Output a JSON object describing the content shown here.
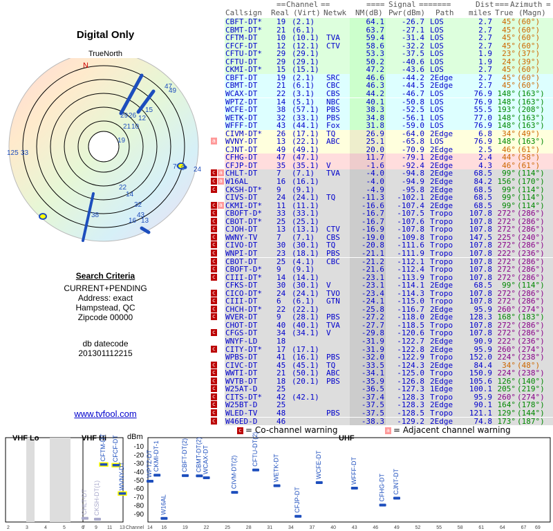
{
  "page": {
    "title": "Digital Only",
    "true_north": "TrueNorth",
    "compass_n": "N",
    "criteria_header": "Search Criteria",
    "criteria_lines": [
      "CURRENT+PENDING",
      "Address: exact",
      "Hampstead, QC",
      "Zipcode 00000"
    ],
    "datecode_label": "db datecode",
    "datecode": "201301112215",
    "site": "www.tvfool.com"
  },
  "radar_labels": [
    "47",
    "49",
    "15",
    "12",
    "29",
    "26",
    "10",
    "19",
    "21",
    "33",
    "7",
    "9",
    "24",
    "38",
    "22",
    "14",
    "32",
    "43",
    "16",
    "13",
    "125"
  ],
  "table_header": {
    "group_channel": "Channel",
    "group_signal": "Signal",
    "group_dist": "Dist",
    "group_azimuth": "Azimuth",
    "callsign": "Callsign",
    "real": "Real",
    "virt": "(Virt)",
    "netwk": "Netwk",
    "nm": "NM(dB)",
    "pwr": "Pwr(dBm)",
    "path": "Path",
    "miles": "miles",
    "true": "True",
    "magn": "(Magn)"
  },
  "colors": {
    "green": "#dfd",
    "cyan": "#dff",
    "yellow": "#ffd",
    "pink": "#fdd",
    "gray": "#ddd",
    "nm_green": "#cfc"
  },
  "rows": [
    {
      "cs": "CBFT-DT*",
      "real": "19",
      "virt": "(2.1)",
      "net": "",
      "nm": "64.1",
      "pwr": "-26.7",
      "path": "LOS",
      "dist": "2.7",
      "true": "45°",
      "magn": "(60°)",
      "bg": "green",
      "az": "#c60",
      "warn": ""
    },
    {
      "cs": "CBMT-DT*",
      "real": "21",
      "virt": "(6.1)",
      "net": "",
      "nm": "63.7",
      "pwr": "-27.1",
      "path": "LOS",
      "dist": "2.7",
      "true": "45°",
      "magn": "(60°)",
      "bg": "green",
      "az": "#c60",
      "warn": ""
    },
    {
      "cs": "CFTM-DT",
      "real": "10",
      "virt": "(10.1)",
      "net": "TVA",
      "nm": "59.4",
      "pwr": "-31.4",
      "path": "LOS",
      "dist": "2.7",
      "true": "45°",
      "magn": "(60°)",
      "bg": "green",
      "az": "#c60",
      "warn": ""
    },
    {
      "cs": "CFCF-DT",
      "real": "12",
      "virt": "(12.1)",
      "net": "CTV",
      "nm": "58.6",
      "pwr": "-32.2",
      "path": "LOS",
      "dist": "2.7",
      "true": "45°",
      "magn": "(60°)",
      "bg": "green",
      "az": "#c60",
      "warn": ""
    },
    {
      "cs": "CFTU-DT*",
      "real": "29",
      "virt": "(29.1)",
      "net": "",
      "nm": "53.3",
      "pwr": "-37.5",
      "path": "LOS",
      "dist": "1.9",
      "true": "23°",
      "magn": "(37°)",
      "bg": "green",
      "az": "#c60",
      "warn": ""
    },
    {
      "cs": "CFTU-DT",
      "real": "29",
      "virt": "(29.1)",
      "net": "",
      "nm": "50.2",
      "pwr": "-40.6",
      "path": "LOS",
      "dist": "1.9",
      "true": "24°",
      "magn": "(39°)",
      "bg": "green",
      "az": "#c60",
      "warn": ""
    },
    {
      "cs": "CKMI-DT*",
      "real": "15",
      "virt": "(15.1)",
      "net": "",
      "nm": "47.2",
      "pwr": "-43.6",
      "path": "LOS",
      "dist": "2.7",
      "true": "45°",
      "magn": "(60°)",
      "bg": "green",
      "az": "#c60",
      "warn": ""
    },
    {
      "cs": "CBFT-DT",
      "real": "19",
      "virt": "(2.1)",
      "net": "SRC",
      "nm": "46.6",
      "pwr": "-44.2",
      "path": "2Edge",
      "dist": "2.7",
      "true": "45°",
      "magn": "(60°)",
      "bg": "cyan",
      "az": "#c60",
      "warn": ""
    },
    {
      "cs": "CBMT-DT",
      "real": "21",
      "virt": "(6.1)",
      "net": "CBC",
      "nm": "46.3",
      "pwr": "-44.5",
      "path": "2Edge",
      "dist": "2.7",
      "true": "45°",
      "magn": "(60°)",
      "bg": "cyan",
      "az": "#c60",
      "warn": ""
    },
    {
      "cs": "WCAX-DT",
      "real": "22",
      "virt": "(3.1)",
      "net": "CBS",
      "nm": "44.2",
      "pwr": "-46.7",
      "path": "LOS",
      "dist": "76.9",
      "true": "148°",
      "magn": "(163°)",
      "bg": "cyan",
      "az": "#080",
      "warn": ""
    },
    {
      "cs": "WPTZ-DT",
      "real": "14",
      "virt": "(5.1)",
      "net": "NBC",
      "nm": "40.1",
      "pwr": "-50.8",
      "path": "LOS",
      "dist": "76.9",
      "true": "148°",
      "magn": "(163°)",
      "bg": "cyan",
      "az": "#080",
      "warn": ""
    },
    {
      "cs": "WCFE-DT",
      "real": "38",
      "virt": "(57.1)",
      "net": "PBS",
      "nm": "38.3",
      "pwr": "-52.5",
      "path": "LOS",
      "dist": "55.5",
      "true": "193°",
      "magn": "(208°)",
      "bg": "cyan",
      "az": "#080",
      "warn": ""
    },
    {
      "cs": "WETK-DT",
      "real": "32",
      "virt": "(33.1)",
      "net": "PBS",
      "nm": "34.8",
      "pwr": "-56.1",
      "path": "LOS",
      "dist": "77.0",
      "true": "148°",
      "magn": "(163°)",
      "bg": "cyan",
      "az": "#080",
      "warn": ""
    },
    {
      "cs": "WFFF-DT",
      "real": "43",
      "virt": "(44.1)",
      "net": "Fox",
      "nm": "31.8",
      "pwr": "-59.0",
      "path": "LOS",
      "dist": "76.9",
      "true": "148°",
      "magn": "(163°)",
      "bg": "cyan",
      "az": "#080",
      "warn": ""
    },
    {
      "cs": "CIVM-DT*",
      "real": "26",
      "virt": "(17.1)",
      "net": "TQ",
      "nm": "26.9",
      "pwr": "-64.0",
      "path": "2Edge",
      "dist": "6.8",
      "true": "34°",
      "magn": "(49°)",
      "bg": "yellow",
      "az": "#c60",
      "warn": ""
    },
    {
      "cs": "WVNY-DT",
      "real": "13",
      "virt": "(22.1)",
      "net": "ABC",
      "nm": "25.1",
      "pwr": "-65.8",
      "path": "LOS",
      "dist": "76.9",
      "true": "148°",
      "magn": "(163°)",
      "bg": "yellow",
      "az": "#080",
      "warn": "a"
    },
    {
      "cs": "CJNT-DT",
      "real": "49",
      "virt": "(49.1)",
      "net": "",
      "nm": "20.0",
      "pwr": "-70.9",
      "path": "2Edge",
      "dist": "2.5",
      "true": "46°",
      "magn": "(61°)",
      "bg": "yellow",
      "az": "#c60",
      "warn": ""
    },
    {
      "cs": "CFHG-DT",
      "real": "47",
      "virt": "(47.1)",
      "net": "",
      "nm": "11.7",
      "pwr": "-79.1",
      "path": "2Edge",
      "dist": "2.4",
      "true": "44°",
      "magn": "(58°)",
      "bg": "pink",
      "az": "#c60",
      "warn": ""
    },
    {
      "cs": "CFJP-DT",
      "real": "35",
      "virt": "(35.1)",
      "net": "V",
      "nm": "-1.6",
      "pwr": "-92.4",
      "path": "2Edge",
      "dist": "4.3",
      "true": "46°",
      "magn": "(61°)",
      "bg": "pink",
      "az": "#c60",
      "warn": ""
    },
    {
      "cs": "CHLT-DT",
      "real": "7",
      "virt": "(7.1)",
      "net": "TVA",
      "nm": "-4.0",
      "pwr": "-94.8",
      "path": "2Edge",
      "dist": "68.5",
      "true": "99°",
      "magn": "(114°)",
      "bg": "gray",
      "az": "#080",
      "warn": "ca"
    },
    {
      "cs": "W16AL",
      "real": "16",
      "virt": "(16.1)",
      "net": "",
      "nm": "-4.0",
      "pwr": "-94.9",
      "path": "2Edge",
      "dist": "84.2",
      "true": "156°",
      "magn": "(170°)",
      "bg": "gray",
      "az": "#080",
      "warn": "ca"
    },
    {
      "cs": "CKSH-DT*",
      "real": "9",
      "virt": "(9.1)",
      "net": "",
      "nm": "-4.9",
      "pwr": "-95.8",
      "path": "2Edge",
      "dist": "68.5",
      "true": "99°",
      "magn": "(114°)",
      "bg": "gray",
      "az": "#080",
      "warn": "c"
    },
    {
      "cs": "CIVS-DT",
      "real": "24",
      "virt": "(24.1)",
      "net": "TQ",
      "nm": "-11.3",
      "pwr": "-102.1",
      "path": "2Edge",
      "dist": "68.5",
      "true": "99°",
      "magn": "(114°)",
      "bg": "gray",
      "az": "#080",
      "warn": ""
    },
    {
      "cs": "CKMI-DT*",
      "real": "11",
      "virt": "(11.1)",
      "net": "",
      "nm": "-16.6",
      "pwr": "-107.4",
      "path": "2Edge",
      "dist": "68.5",
      "true": "99°",
      "magn": "(114°)",
      "bg": "gray",
      "az": "#080",
      "warn": "ca"
    },
    {
      "cs": "CBOFT-D*",
      "real": "33",
      "virt": "(33.1)",
      "net": "",
      "nm": "-16.7",
      "pwr": "-107.5",
      "path": "Tropo",
      "dist": "107.8",
      "true": "272°",
      "magn": "(286°)",
      "bg": "gray",
      "az": "#808",
      "warn": "c"
    },
    {
      "cs": "CBOT-DT*",
      "real": "25",
      "virt": "(25.1)",
      "net": "",
      "nm": "-16.7",
      "pwr": "-107.6",
      "path": "Tropo",
      "dist": "107.8",
      "true": "272°",
      "magn": "(286°)",
      "bg": "gray",
      "az": "#808",
      "warn": "c"
    },
    {
      "cs": "CJOH-DT",
      "real": "13",
      "virt": "(13.1)",
      "net": "CTV",
      "nm": "-16.9",
      "pwr": "-107.8",
      "path": "Tropo",
      "dist": "107.8",
      "true": "272°",
      "magn": "(286°)",
      "bg": "gray",
      "az": "#808",
      "warn": "c"
    },
    {
      "cs": "WWNY-TV",
      "real": "7",
      "virt": "(7.1)",
      "net": "CBS",
      "nm": "-19.0",
      "pwr": "-109.8",
      "path": "Tropo",
      "dist": "147.5",
      "true": "225°",
      "magn": "(240°)",
      "bg": "gray",
      "az": "#808",
      "warn": "c"
    },
    {
      "cs": "CIVO-DT",
      "real": "30",
      "virt": "(30.1)",
      "net": "TQ",
      "nm": "-20.8",
      "pwr": "-111.6",
      "path": "Tropo",
      "dist": "107.8",
      "true": "272°",
      "magn": "(286°)",
      "bg": "gray",
      "az": "#808",
      "warn": "c"
    },
    {
      "cs": "WNPI-DT",
      "real": "23",
      "virt": "(18.1)",
      "net": "PBS",
      "nm": "-21.1",
      "pwr": "-111.9",
      "path": "Tropo",
      "dist": "107.8",
      "true": "222°",
      "magn": "(236°)",
      "bg": "gray",
      "az": "#808",
      "warn": "c"
    },
    {
      "cs": "CBOT-DT",
      "real": "25",
      "virt": "(4.1)",
      "net": "CBC",
      "nm": "-21.2",
      "pwr": "-112.1",
      "path": "Tropo",
      "dist": "107.8",
      "true": "272°",
      "magn": "(286°)",
      "bg": "gray",
      "az": "#808",
      "warn": "c"
    },
    {
      "cs": "CBOFT-D*",
      "real": "9",
      "virt": "(9.1)",
      "net": "",
      "nm": "-21.6",
      "pwr": "-112.4",
      "path": "Tropo",
      "dist": "107.8",
      "true": "272°",
      "magn": "(286°)",
      "bg": "gray",
      "az": "#808",
      "warn": "c"
    },
    {
      "cs": "CIII-DT*",
      "real": "14",
      "virt": "(14.1)",
      "net": "",
      "nm": "-23.1",
      "pwr": "-113.9",
      "path": "Tropo",
      "dist": "107.8",
      "true": "272°",
      "magn": "(286°)",
      "bg": "gray",
      "az": "#808",
      "warn": "c"
    },
    {
      "cs": "CFKS-DT",
      "real": "30",
      "virt": "(30.1)",
      "net": "V",
      "nm": "-23.1",
      "pwr": "-114.1",
      "path": "2Edge",
      "dist": "68.5",
      "true": "99°",
      "magn": "(114°)",
      "bg": "gray",
      "az": "#080",
      "warn": ""
    },
    {
      "cs": "CICO-DT*",
      "real": "24",
      "virt": "(24.1)",
      "net": "TVO",
      "nm": "-23.4",
      "pwr": "-114.3",
      "path": "Tropo",
      "dist": "107.8",
      "true": "272°",
      "magn": "(286°)",
      "bg": "gray",
      "az": "#808",
      "warn": "c"
    },
    {
      "cs": "CIII-DT",
      "real": "6",
      "virt": "(6.1)",
      "net": "GTN",
      "nm": "-24.1",
      "pwr": "-115.0",
      "path": "Tropo",
      "dist": "107.8",
      "true": "272°",
      "magn": "(286°)",
      "bg": "gray",
      "az": "#808",
      "warn": "c"
    },
    {
      "cs": "CHCH-DT*",
      "real": "22",
      "virt": "(22.1)",
      "net": "",
      "nm": "-25.8",
      "pwr": "-116.7",
      "path": "2Edge",
      "dist": "95.9",
      "true": "260°",
      "magn": "(274°)",
      "bg": "gray",
      "az": "#808",
      "warn": "c"
    },
    {
      "cs": "WVER-DT",
      "real": "9",
      "virt": "(28.1)",
      "net": "PBS",
      "nm": "-27.2",
      "pwr": "-118.0",
      "path": "2Edge",
      "dist": "128.3",
      "true": "168°",
      "magn": "(183°)",
      "bg": "gray",
      "az": "#080",
      "warn": "c"
    },
    {
      "cs": "CHOT-DT",
      "real": "40",
      "virt": "(40.1)",
      "net": "TVA",
      "nm": "-27.7",
      "pwr": "-118.5",
      "path": "Tropo",
      "dist": "107.8",
      "true": "272°",
      "magn": "(286°)",
      "bg": "gray",
      "az": "#808",
      "warn": ""
    },
    {
      "cs": "CFGS-DT",
      "real": "34",
      "virt": "(34.1)",
      "net": "V",
      "nm": "-29.8",
      "pwr": "-120.6",
      "path": "Tropo",
      "dist": "107.8",
      "true": "272°",
      "magn": "(286°)",
      "bg": "gray",
      "az": "#808",
      "warn": "c"
    },
    {
      "cs": "WNYF-LD",
      "real": "18",
      "virt": "",
      "net": "",
      "nm": "-31.9",
      "pwr": "-122.7",
      "path": "2Edge",
      "dist": "90.9",
      "true": "222°",
      "magn": "(236°)",
      "bg": "gray",
      "az": "#808",
      "warn": ""
    },
    {
      "cs": "CITY-DT*",
      "real": "17",
      "virt": "(17.1)",
      "net": "",
      "nm": "-31.9",
      "pwr": "-122.8",
      "path": "2Edge",
      "dist": "95.9",
      "true": "260°",
      "magn": "(274°)",
      "bg": "gray",
      "az": "#808",
      "warn": "c"
    },
    {
      "cs": "WPBS-DT",
      "real": "41",
      "virt": "(16.1)",
      "net": "PBS",
      "nm": "-32.0",
      "pwr": "-122.9",
      "path": "Tropo",
      "dist": "152.0",
      "true": "224°",
      "magn": "(238°)",
      "bg": "gray",
      "az": "#808",
      "warn": ""
    },
    {
      "cs": "CIVC-DT",
      "real": "45",
      "virt": "(45.1)",
      "net": "TQ",
      "nm": "-33.5",
      "pwr": "-124.3",
      "path": "2Edge",
      "dist": "84.4",
      "true": "34°",
      "magn": "(48°)",
      "bg": "gray",
      "az": "#c60",
      "warn": "c"
    },
    {
      "cs": "WWTI-DT",
      "real": "21",
      "virt": "(50.1)",
      "net": "ABC",
      "nm": "-34.1",
      "pwr": "-125.0",
      "path": "Tropo",
      "dist": "150.9",
      "true": "224°",
      "magn": "(238°)",
      "bg": "gray",
      "az": "#808",
      "warn": "c"
    },
    {
      "cs": "WVTB-DT",
      "real": "18",
      "virt": "(20.1)",
      "net": "PBS",
      "nm": "-35.9",
      "pwr": "-126.8",
      "path": "2Edge",
      "dist": "105.6",
      "true": "126°",
      "magn": "(140°)",
      "bg": "gray",
      "az": "#080",
      "warn": "c"
    },
    {
      "cs": "W25AT-D",
      "real": "25",
      "virt": "",
      "net": "",
      "nm": "-36.5",
      "pwr": "-127.3",
      "path": "1Edge",
      "dist": "100.1",
      "true": "205°",
      "magn": "(219°)",
      "bg": "gray",
      "az": "#080",
      "warn": "c"
    },
    {
      "cs": "CITS-DT*",
      "real": "42",
      "virt": "(42.1)",
      "net": "",
      "nm": "-37.4",
      "pwr": "-128.3",
      "path": "Tropo",
      "dist": "95.9",
      "true": "260°",
      "magn": "(274°)",
      "bg": "gray",
      "az": "#808",
      "warn": "c"
    },
    {
      "cs": "W25BT-D",
      "real": "25",
      "virt": "",
      "net": "",
      "nm": "-37.5",
      "pwr": "-128.3",
      "path": "2Edge",
      "dist": "90.1",
      "true": "164°",
      "magn": "(178°)",
      "bg": "gray",
      "az": "#080",
      "warn": "c"
    },
    {
      "cs": "WLED-TV",
      "real": "48",
      "virt": "",
      "net": "PBS",
      "nm": "-37.5",
      "pwr": "-128.5",
      "path": "Tropo",
      "dist": "121.1",
      "true": "129°",
      "magn": "(144°)",
      "bg": "gray",
      "az": "#080",
      "warn": "c"
    },
    {
      "cs": "W46ED-D",
      "real": "46",
      "virt": "",
      "net": "",
      "nm": "-38.3",
      "pwr": "-129.2",
      "path": "2Edge",
      "dist": "74.8",
      "true": "173°",
      "magn": "(187°)",
      "bg": "gray",
      "az": "#080",
      "warn": "c"
    }
  ],
  "legend": {
    "co": "= Co-channel warning",
    "adj": "= Adjacent channel warning",
    "co_mark": "c",
    "adj_mark": "a"
  },
  "spectrum": {
    "vhf_lo": "VHF Lo",
    "vhf_hi": "VHF Hi",
    "uhf": "UHF",
    "dbm": "dBm",
    "y_ticks": [
      "-10",
      "-20",
      "-30",
      "-40",
      "-50",
      "-60",
      "-70",
      "-80",
      "-90"
    ],
    "lo_ticks": [
      "2",
      "3",
      "4",
      "5",
      "6"
    ],
    "hi_ticks": [
      "7",
      "9",
      "11",
      "13"
    ],
    "uhf_ticks": [
      "14",
      "16",
      "19",
      "22",
      "25",
      "28",
      "31",
      "34",
      "37",
      "40",
      "43",
      "46",
      "49",
      "52",
      "55",
      "58",
      "61",
      "64",
      "67",
      "69"
    ],
    "channel_label": "Channel",
    "stations": [
      {
        "label": "CFTM-DT",
        "ch": 10,
        "pwr": -31.4,
        "good": true
      },
      {
        "label": "CFCF-DT",
        "ch": 12,
        "pwr": -32.2,
        "good": true
      },
      {
        "label": "WVNY-DT",
        "ch": 13,
        "pwr": -65.8,
        "good": true
      },
      {
        "label": "CHLT-DT",
        "ch": 7,
        "pwr": -94.8,
        "good": false
      },
      {
        "label": "CKSH-DT(1)",
        "ch": 9,
        "pwr": -95.8,
        "good": false
      },
      {
        "label": "WPTZ-DT",
        "ch": 14,
        "pwr": -50.8,
        "good": true
      },
      {
        "label": "CKMI-DT-1",
        "ch": 15,
        "pwr": -43.6,
        "good": true
      },
      {
        "label": "W16AL",
        "ch": 16,
        "pwr": -94.9,
        "good": true
      },
      {
        "label": "CBFT-DT(2)",
        "ch": 19,
        "pwr": -44.2,
        "good": true
      },
      {
        "label": "CBMT-DT(2)",
        "ch": 21,
        "pwr": -44.5,
        "good": true
      },
      {
        "label": "WCAX-DT",
        "ch": 22,
        "pwr": -46.7,
        "good": true
      },
      {
        "label": "CIVM-DT(2)",
        "ch": 26,
        "pwr": -64.0,
        "good": true
      },
      {
        "label": "CFTU-DT(2)",
        "ch": 29,
        "pwr": -37.5,
        "good": true
      },
      {
        "label": "WETK-DT",
        "ch": 32,
        "pwr": -56.1,
        "good": true
      },
      {
        "label": "CFJP-DT",
        "ch": 35,
        "pwr": -92.4,
        "good": true
      },
      {
        "label": "WCFE-DT",
        "ch": 38,
        "pwr": -52.5,
        "good": true
      },
      {
        "label": "WFFF-DT",
        "ch": 43,
        "pwr": -59.0,
        "good": true
      },
      {
        "label": "CFHG-DT",
        "ch": 47,
        "pwr": -79.1,
        "good": true
      },
      {
        "label": "CJNT-DT",
        "ch": 49,
        "pwr": -70.9,
        "good": true
      }
    ]
  }
}
